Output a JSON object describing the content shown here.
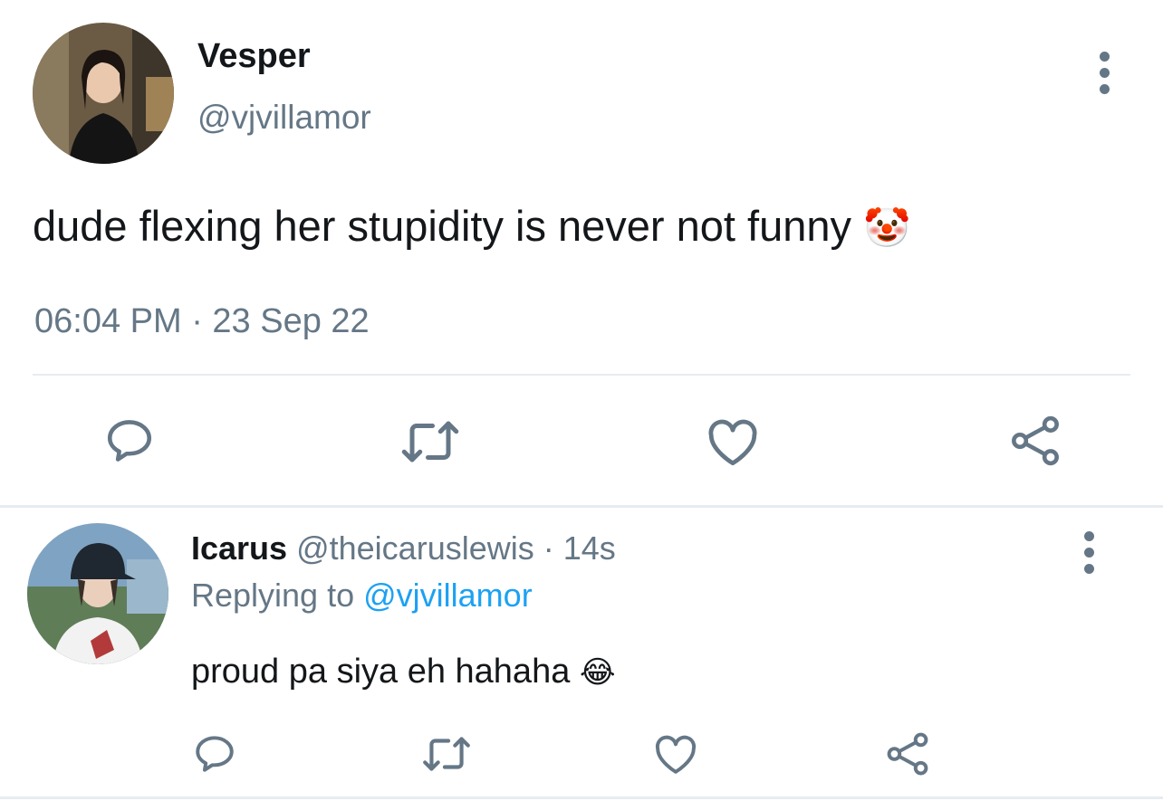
{
  "main_tweet": {
    "display_name": "Vesper",
    "handle": "@vjvillamor",
    "text": "dude flexing her stupidity is never not funny",
    "emoji": "🤡",
    "timestamp": "06:04 PM · 23 Sep 22"
  },
  "reply": {
    "display_name": "Icarus",
    "handle": "@theicaruslewis",
    "separator": "·",
    "time_ago": "14s",
    "replying_prefix": "Replying to",
    "replying_to": "@vjvillamor",
    "text": "proud pa siya eh hahaha",
    "emoji": "😂"
  },
  "colors": {
    "text": "#14171a",
    "muted": "#657786",
    "link": "#1da1f2",
    "divider": "#e6ecf0"
  },
  "icons": [
    "more-vertical-icon",
    "reply-icon",
    "retweet-icon",
    "like-icon",
    "share-icon"
  ]
}
